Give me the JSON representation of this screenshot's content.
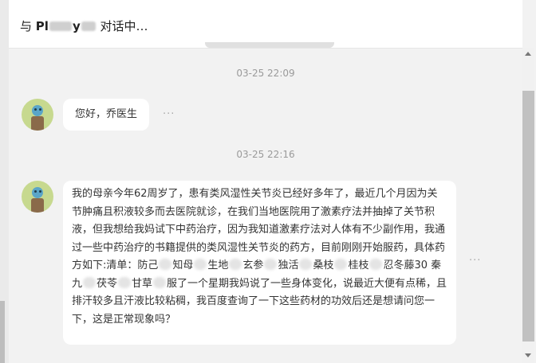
{
  "header": {
    "prefix": "与",
    "name_visible": "Pl",
    "name_tail": "y",
    "suffix": "对话中…"
  },
  "messages": [
    {
      "timestamp": "03-25 22:09",
      "text": "您好，乔医生",
      "more": "···"
    },
    {
      "timestamp": "03-25 22:16",
      "part1": "我的母亲今年62周岁了，患有类风湿性关节炎已经好多年了，最近几个月因为关节肿痛且积液较多而去医院就诊，在我们当地医院用了激素疗法并抽掉了关节积液，但我想给我妈试下中药治疗，因为我知道激素疗法对人体有不少副作用，我通过一些中药治疗的书籍提供的类风湿性关节炎的药方，目前刚刚开始服药，具体药方如下:清单：防己",
      "part2": "知母",
      "part3": "生地",
      "part4": "玄参",
      "part5": "独活",
      "part6": "桑枝",
      "part7": "桂枝",
      "part8": "忍冬藤30 秦九",
      "part9": "茯苓",
      "part10": "甘草",
      "part11": "服了一个星期我妈说了一些身体变化，说最近大便有点稀，且排汗较多且汗液比较粘稠，我百度查询了一下这些药材的功效后还是想请问您一下，这是正常现象吗？",
      "more": "···"
    }
  ]
}
